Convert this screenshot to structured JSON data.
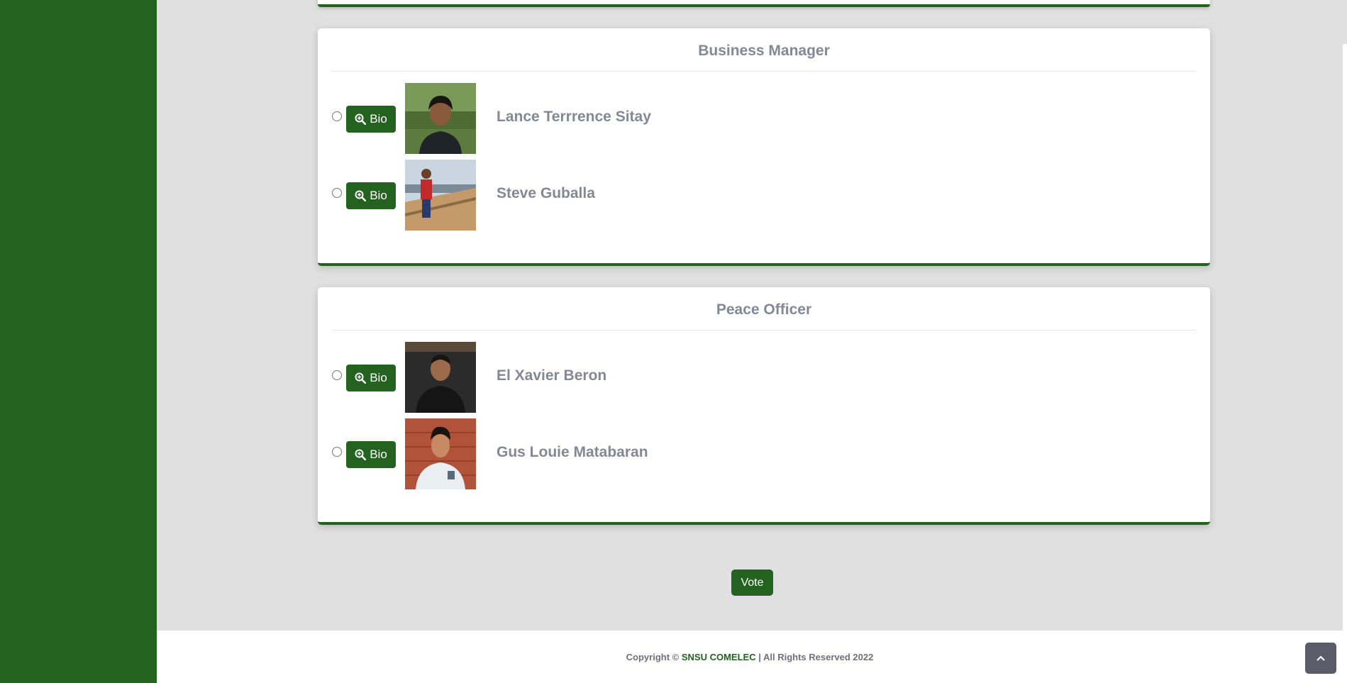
{
  "sections": [
    {
      "title": "Business Manager",
      "candidates": [
        {
          "name": "Lance Terrrence Sitay",
          "bio_label": "Bio",
          "photo": "portrait-green-background"
        },
        {
          "name": "Steve Guballa",
          "bio_label": "Bio",
          "photo": "portrait-boardwalk-red-shirt"
        }
      ]
    },
    {
      "title": "Peace Officer",
      "candidates": [
        {
          "name": "El Xavier Beron",
          "bio_label": "Bio",
          "photo": "portrait-dark-jacket"
        },
        {
          "name": "Gus Louie Matabaran",
          "bio_label": "Bio",
          "photo": "portrait-brick-wall"
        }
      ]
    }
  ],
  "vote_label": "Vote",
  "footer": {
    "prefix": "Copyright ©",
    "brand": "SNSU COMELEC",
    "suffix": "| All Rights Reserved 2022"
  },
  "icons": {
    "bio": "search-plus-icon",
    "scroll_top": "chevron-up-icon"
  },
  "colors": {
    "primary": "#23621f",
    "text_muted": "#858796",
    "page_bg": "#e0e0e0"
  }
}
